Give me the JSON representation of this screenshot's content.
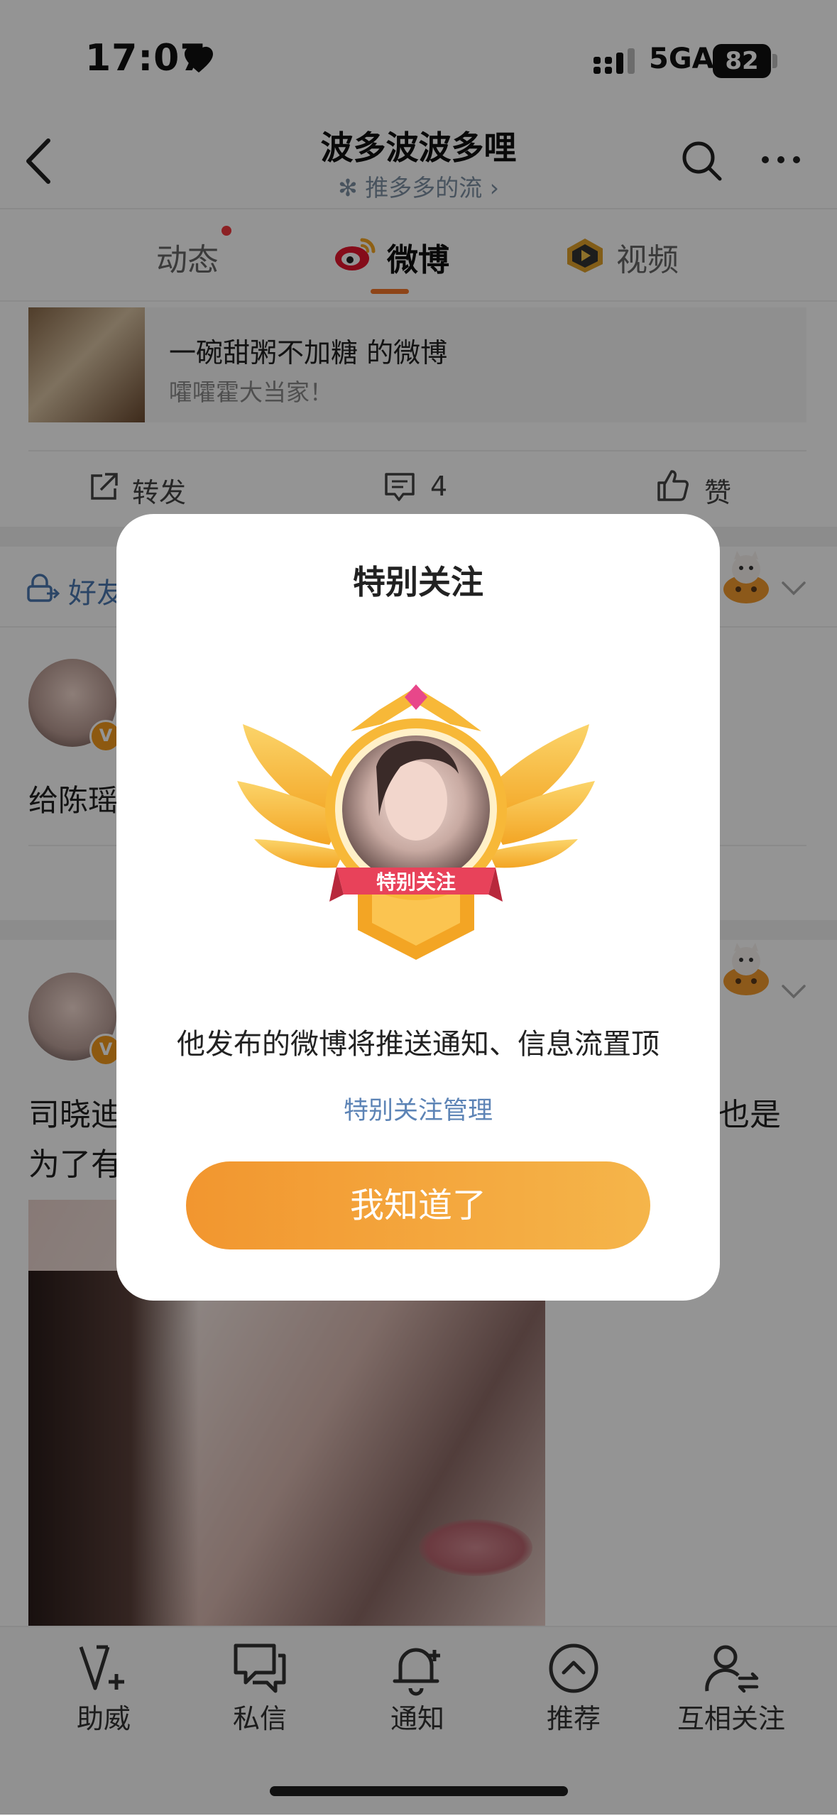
{
  "status_bar": {
    "time": "17:07",
    "network": "5GA",
    "battery": "82"
  },
  "header": {
    "title": "波多波波多哩",
    "subtitle": "✻ 推多多的流 ›"
  },
  "tabs": [
    {
      "label": "动态"
    },
    {
      "label": "微博"
    },
    {
      "label": "视频"
    }
  ],
  "repost_card": {
    "title": "一碗甜粥不加糖 的微博",
    "subtitle": "嚯嚯霍大当家！"
  },
  "actions": {
    "share": "转发",
    "comments": "4",
    "like": "赞"
  },
  "feed": {
    "friends_label": "好友",
    "post1_text": "给陈瑶",
    "post2_line1": "司晓迪",
    "post2_line2": "为了有",
    "post2_tail": "也是",
    "verified_badge": "V"
  },
  "modal": {
    "title": "特别关注",
    "description": "他发布的微博将推送通知、信息流置顶",
    "manage_link": "特别关注管理",
    "confirm_button": "我知道了"
  },
  "bottom_nav": [
    {
      "label": "助威",
      "icon": "v-plus-icon"
    },
    {
      "label": "私信",
      "icon": "message-icon"
    },
    {
      "label": "通知",
      "icon": "bell-icon"
    },
    {
      "label": "推荐",
      "icon": "chevron-up-circle-icon"
    },
    {
      "label": "互相关注",
      "icon": "mutual-follow-icon"
    }
  ],
  "colors": {
    "accent": "#f5782a",
    "link": "#5d84b6",
    "button_start": "#f2962f",
    "button_end": "#f5b54a"
  }
}
